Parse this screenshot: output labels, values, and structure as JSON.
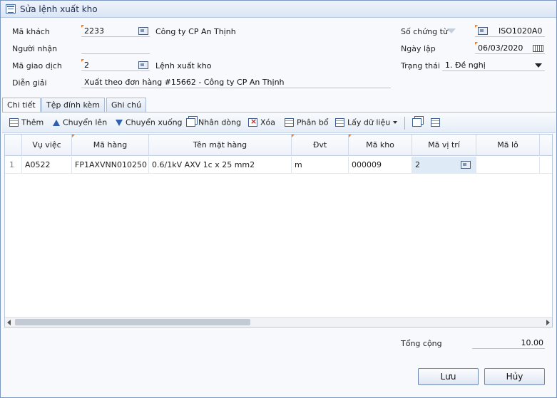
{
  "window": {
    "title": "Sửa lệnh xuất kho"
  },
  "form": {
    "ma_khach": {
      "label": "Mã khách",
      "value": "2233",
      "name": "Công ty CP An Thịnh"
    },
    "nguoi_nhan": {
      "label": "Người nhận",
      "value": ""
    },
    "ma_giao_dich": {
      "label": "Mã giao dịch",
      "value": "2",
      "name": "Lệnh xuất kho"
    },
    "dien_giai": {
      "label": "Diễn giải",
      "value": "Xuất theo đơn hàng #15662 - Công ty CP An Thịnh"
    },
    "so_chung_tu": {
      "label": "Số chứng từ",
      "value": "ISO1020A0"
    },
    "ngay_lap": {
      "label": "Ngày lập",
      "value": "06/03/2020"
    },
    "trang_thai": {
      "label": "Trạng thái",
      "value": "1. Đề nghị"
    }
  },
  "tabs": [
    "Chi tiết",
    "Tệp đính kèm",
    "Ghi chú"
  ],
  "toolbar": {
    "them": "Thêm",
    "chuyen_len": "Chuyển lên",
    "chuyen_xuong": "Chuyển xuống",
    "nhan_dong": "Nhân dòng",
    "xoa": "Xóa",
    "phan_bo": "Phân bổ",
    "lay_du_lieu": "Lấy dữ liệu"
  },
  "grid": {
    "columns": [
      "Vụ việc",
      "Mã hàng",
      "Tên mặt hàng",
      "Đvt",
      "Mã kho",
      "Mã vị trí",
      "Mã lô"
    ],
    "rows": [
      {
        "num": "1",
        "vu_viec": "A0522",
        "ma_hang": "FP1AXVNN010250",
        "ten_mat_hang": "0.6/1kV AXV 1c x 25 mm2",
        "dvt": "m",
        "ma_kho": "000009",
        "ma_vi_tri": "2",
        "ma_lo": ""
      }
    ]
  },
  "footer": {
    "tong_cong_label": "Tổng cộng",
    "tong_cong_value": "10.00"
  },
  "buttons": {
    "luu": "Lưu",
    "huy": "Hủy"
  }
}
